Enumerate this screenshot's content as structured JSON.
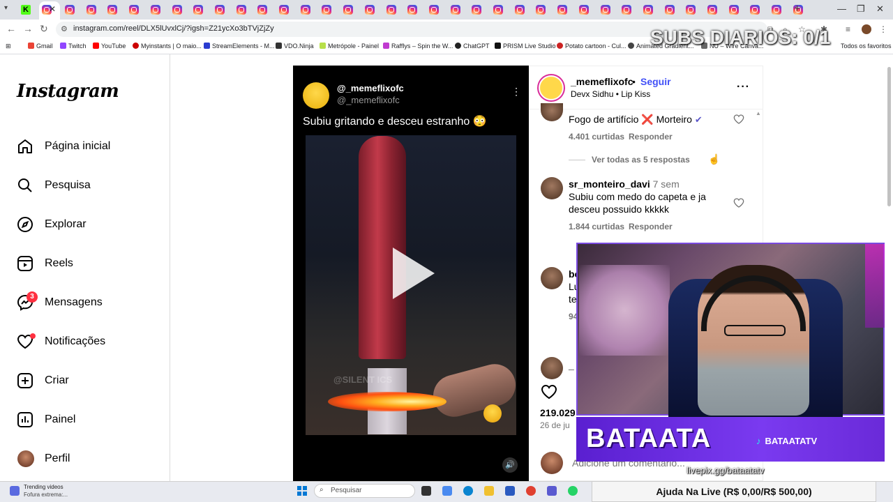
{
  "browser": {
    "url": "instagram.com/reel/DLX5lUvxlCj/?igsh=Z21ycXo3bTVjZjZy",
    "bookmarks": [
      "Gmail",
      "Twitch",
      "YouTube",
      "Myinstants | O maio...",
      "StreamElements - M...",
      "VDO.Ninja",
      "Metrópole - Painel",
      "Rafflys – Spin the W...",
      "ChatGPT",
      "PRISM Live Studio",
      "Potato cartoon - Cul...",
      "Animated Gradient...",
      "NU – Wire Canva...",
      "Todos os favoritos"
    ],
    "tab_k_label": "K"
  },
  "stream_overlay": {
    "subs_counter": "SUBS DIARIOS: 0/1",
    "banner_name": "BATAATA",
    "tiktok_handle": "BATAATATV",
    "livepix": "livepix.gg/bataatatv",
    "donation_goal": "Ajuda Na Live (R$ 0,00/R$ 500,00)"
  },
  "sidebar": {
    "logo": "Instagram",
    "items": [
      {
        "label": "Página inicial",
        "icon": "home-icon"
      },
      {
        "label": "Pesquisa",
        "icon": "search-icon"
      },
      {
        "label": "Explorar",
        "icon": "compass-icon"
      },
      {
        "label": "Reels",
        "icon": "reels-icon"
      },
      {
        "label": "Mensagens",
        "icon": "messenger-icon"
      },
      {
        "label": "Notificações",
        "icon": "heart-icon"
      },
      {
        "label": "Criar",
        "icon": "plus-square-icon"
      },
      {
        "label": "Painel",
        "icon": "chart-icon"
      },
      {
        "label": "Perfil",
        "icon": "avatar"
      }
    ],
    "messages_badge": "3"
  },
  "video": {
    "display_name": "@_memeflixofc",
    "handle": "@_memeflixofc",
    "caption": "Subiu gritando e desceu estranho 😳",
    "watermark": "@SILENT      ICS"
  },
  "panel": {
    "username": "_memeflixofc",
    "dot": "•",
    "follow_label": "Seguir",
    "audio": "Devx Sidhu • Lip Kiss",
    "comments": [
      {
        "text": "Fogo de artifício ❌ Morteiro",
        "likes": "4.401 curtidas",
        "reply": "Responder"
      },
      {
        "user": "sr_monteiro_davi",
        "time": "7 sem",
        "text_line1": "Subiu com medo do capeta e ja",
        "text_line2": "desceu possuido kkkkk",
        "likes": "1.844 curtidas",
        "reply": "Responder"
      }
    ],
    "view_replies": "Ver todas as 5 respostas",
    "partial_user": "bo",
    "partial_line1": "Lu",
    "partial_line2": "te",
    "partial_likes": "94",
    "partial_user2": "_",
    "likes_total": "219.029",
    "date": "26 de ju",
    "comment_placeholder": "Adicione um comentário..."
  },
  "taskbar": {
    "weather_title": "Trending videos",
    "weather_sub": "Fofura extrema:...",
    "search_placeholder": "Pesquisar"
  }
}
